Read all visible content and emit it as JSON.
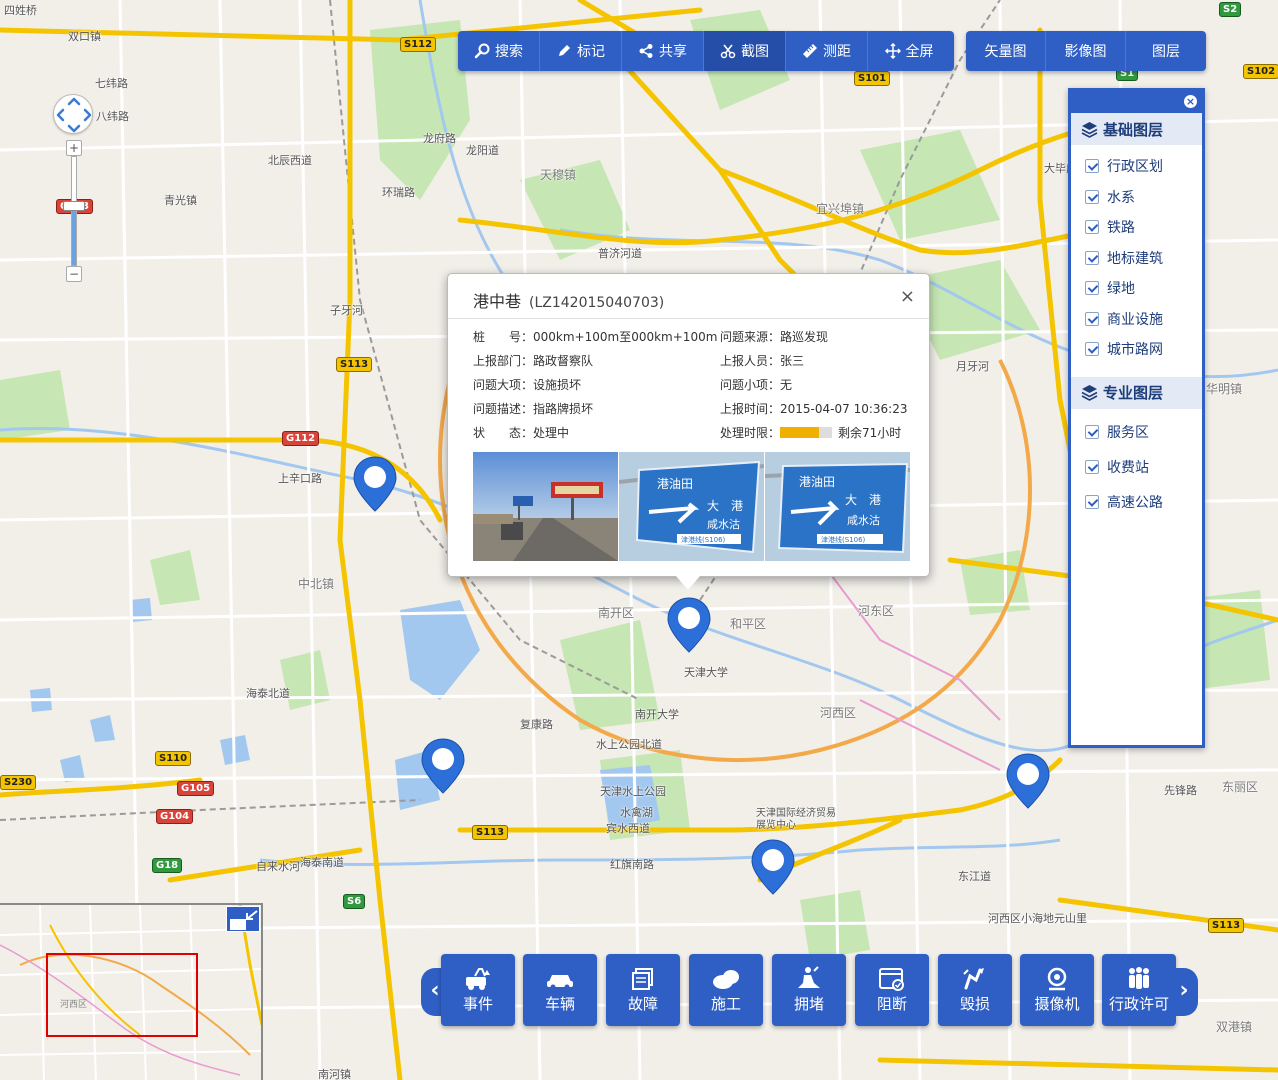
{
  "map": {
    "labels": [
      {
        "text": "四姓桥"
      },
      {
        "text": "双口镇"
      },
      {
        "text": "七纬路"
      },
      {
        "text": "八纬路"
      },
      {
        "text": "北辰西道"
      },
      {
        "text": "青光镇"
      },
      {
        "text": "龙府路"
      },
      {
        "text": "龙阳道"
      },
      {
        "text": "环瑞路"
      },
      {
        "text": "天穆镇"
      },
      {
        "text": "宜兴埠镇"
      },
      {
        "text": "普济河道"
      },
      {
        "text": "子牙河"
      },
      {
        "text": "中北镇"
      },
      {
        "text": "上辛口路"
      },
      {
        "text": "南开区"
      },
      {
        "text": "和平区"
      },
      {
        "text": "河东区"
      },
      {
        "text": "河西区"
      },
      {
        "text": "天津大学"
      },
      {
        "text": "南开大学"
      },
      {
        "text": "水上公园北道"
      },
      {
        "text": "天津水上公园"
      },
      {
        "text": "水禽湖"
      },
      {
        "text": "宾水西道"
      },
      {
        "text": "天津国际经济贸易展览中心"
      },
      {
        "text": "海泰北道"
      },
      {
        "text": "复康路"
      },
      {
        "text": "红旗南路"
      },
      {
        "text": "东丽区"
      },
      {
        "text": "华明镇"
      },
      {
        "text": "月牙河"
      },
      {
        "text": "海泰南道"
      },
      {
        "text": "自来水河"
      },
      {
        "text": "东江道"
      },
      {
        "text": "河西区小海地元山里"
      },
      {
        "text": "先锋路"
      },
      {
        "text": "双港镇"
      },
      {
        "text": "南河镇"
      },
      {
        "text": "大毕庄"
      }
    ],
    "shields": [
      {
        "text": "S112"
      },
      {
        "text": "S101"
      },
      {
        "text": "S2"
      },
      {
        "text": "S1"
      },
      {
        "text": "S102"
      },
      {
        "text": "S113"
      },
      {
        "text": "G112"
      },
      {
        "text": "S110"
      },
      {
        "text": "G105"
      },
      {
        "text": "G104"
      },
      {
        "text": "S230"
      },
      {
        "text": "G18"
      },
      {
        "text": "S6"
      },
      {
        "text": "S113"
      },
      {
        "text": "S113"
      },
      {
        "text": "G103"
      }
    ]
  },
  "toolbar": {
    "tools": [
      {
        "label": "搜索",
        "icon": "search-icon"
      },
      {
        "label": "标记",
        "icon": "pen-icon"
      },
      {
        "label": "共享",
        "icon": "share-icon"
      },
      {
        "label": "截图",
        "icon": "scissors-icon",
        "active": true
      },
      {
        "label": "测距",
        "icon": "ruler-icon"
      },
      {
        "label": "全屏",
        "icon": "fullscreen-icon"
      }
    ],
    "maps": [
      {
        "label": "矢量图"
      },
      {
        "label": "影像图"
      },
      {
        "label": "图层"
      }
    ]
  },
  "zoom": {
    "in": "+",
    "out": "−",
    "level": 0.55
  },
  "layers": {
    "close": "×",
    "base_title": "基础图层",
    "base_items": [
      "行政区划",
      "水系",
      "铁路",
      "地标建筑",
      "绿地",
      "商业设施",
      "城市路网"
    ],
    "pro_title": "专业图层",
    "pro_items": [
      "服务区",
      "收费站",
      "高速公路"
    ]
  },
  "popup": {
    "title": "港中巷",
    "code": "(LZ142015040703)",
    "close": "×",
    "fields": {
      "stake_label": "桩　　号：",
      "stake_value": "000km+100m至000km+100m",
      "source_label": "问题来源：",
      "source_value": "路巡发现",
      "dept_label": "上报部门：",
      "dept_value": "路政督察队",
      "reporter_label": "上报人员：",
      "reporter_value": "张三",
      "major_label": "问题大项：",
      "major_value": "设施损坏",
      "minor_label": "问题小项：",
      "minor_value": "无",
      "desc_label": "问题描述：",
      "desc_value": "指路牌损坏",
      "time_label": "上报时间：",
      "time_value": "2015-04-07 10:36:23",
      "status_label": "状　　态：",
      "status_value": "处理中",
      "limit_label": "处理时限：",
      "limit_value": "剩余71小时",
      "limit_progress": 0.75
    },
    "photo_sign_text": {
      "line1": "港油田",
      "line2": "大　港",
      "line3": "咸水沽",
      "plate": "津港线(S106)"
    }
  },
  "categories": {
    "prev": "‹",
    "next": "›",
    "items": [
      {
        "label": "事件",
        "icon": "event-icon"
      },
      {
        "label": "车辆",
        "icon": "car-icon"
      },
      {
        "label": "故障",
        "icon": "fault-icon"
      },
      {
        "label": "施工",
        "icon": "construction-icon"
      },
      {
        "label": "拥堵",
        "icon": "congestion-icon"
      },
      {
        "label": "阻断",
        "icon": "blocked-icon"
      },
      {
        "label": "毁损",
        "icon": "damage-icon"
      },
      {
        "label": "摄像机",
        "icon": "camera-icon"
      },
      {
        "label": "行政许可",
        "icon": "permit-icon"
      }
    ]
  },
  "minimap": {
    "label": "河西区"
  },
  "colors": {
    "primary": "#2f5fc4",
    "road_main": "#f5c400",
    "water": "#a3c8f0",
    "green": "#c6e6b3",
    "marker": "#2d6fd9"
  }
}
